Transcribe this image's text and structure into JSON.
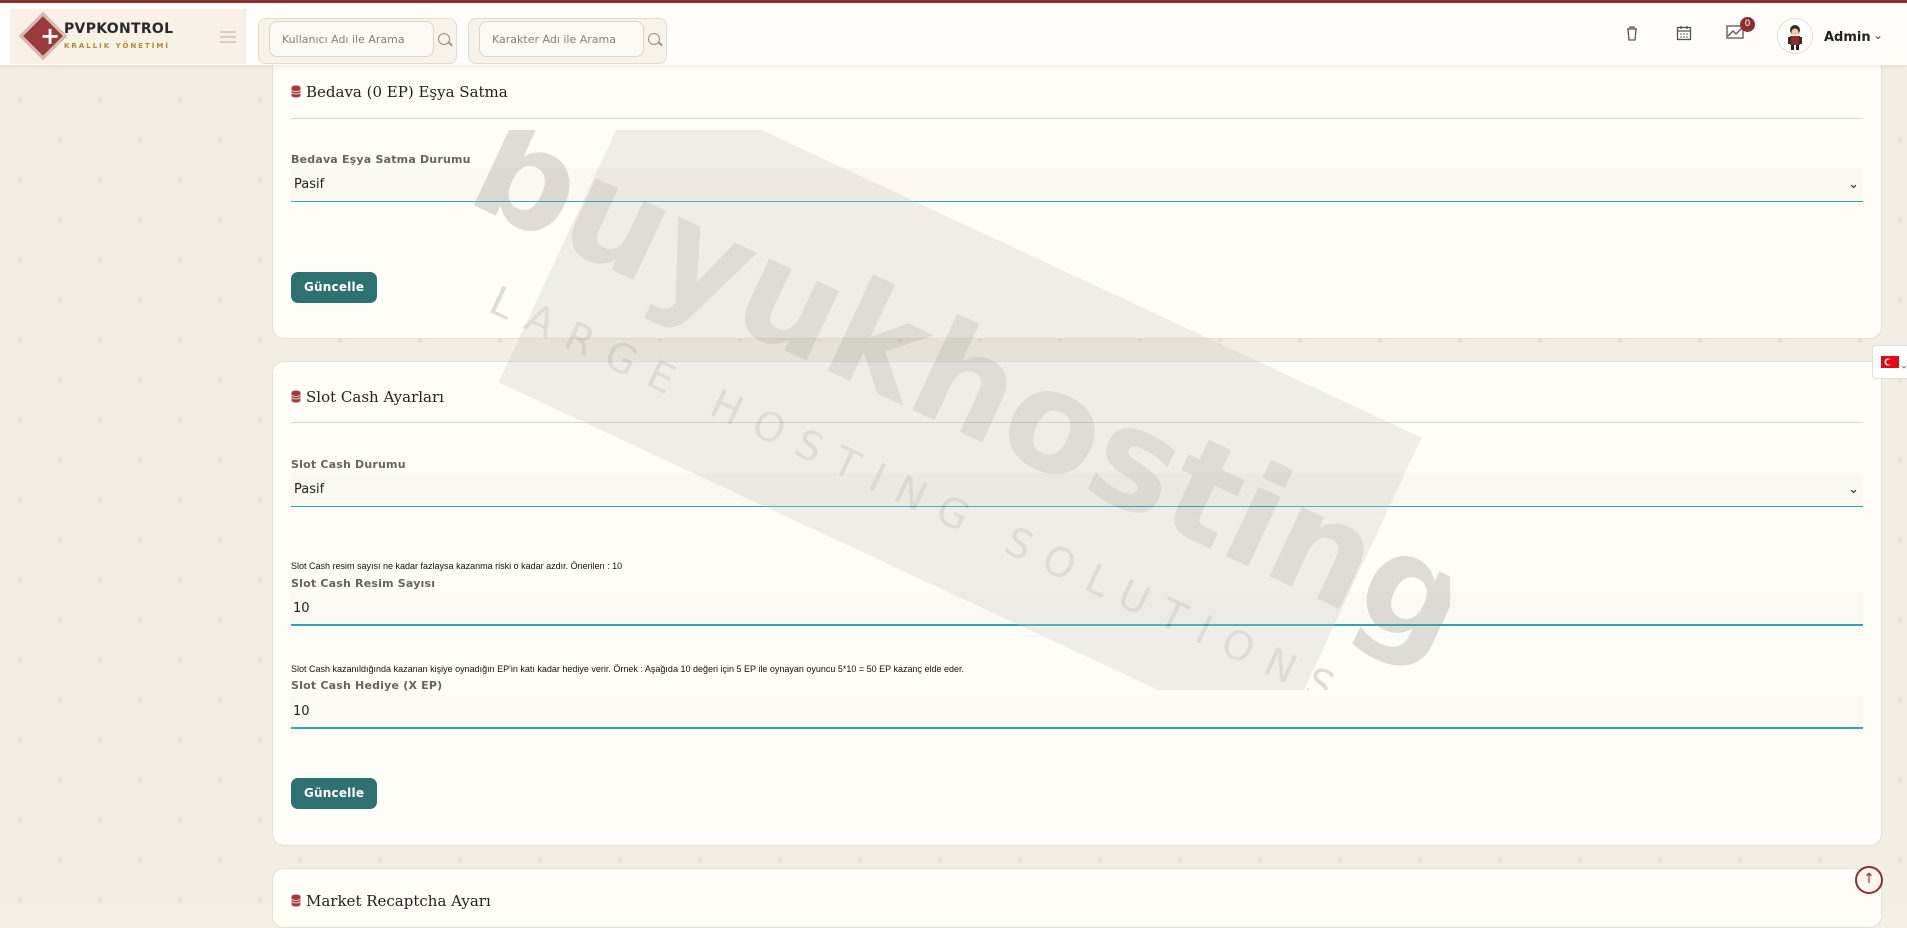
{
  "brand": {
    "title": "PVPKONTROL",
    "subtitle": "KRALLIK YÖNETİMİ"
  },
  "search": {
    "username_placeholder": "Kullanıcı Adı ile Arama",
    "character_placeholder": "Karakter Adı ile Arama"
  },
  "header": {
    "notification_count": "0",
    "user_name": "Admin"
  },
  "colors": {
    "accent": "#8b2f2f",
    "button": "#2e7171",
    "input_underline": "#2aa6b8"
  },
  "sections": [
    {
      "title": "Bedava (0 EP) Eşya Satma",
      "fields": [
        {
          "label": "Bedava Eşya Satma Durumu",
          "value": "Pasif"
        }
      ],
      "button": "Güncelle"
    },
    {
      "title": "Slot Cash Ayarları",
      "fields": [
        {
          "label": "Slot Cash Durumu",
          "value": "Pasif"
        },
        {
          "hint": "Slot Cash resim sayısı ne kadar fazlaysa kazanma riski o kadar azdır. Önerilen : 10",
          "label": "Slot Cash Resim Sayısı",
          "value": "10"
        },
        {
          "hint": "Slot Cash kazanıldığında kazanan kişiye oynadığın EP'in katı kadar hediye verir. Örnek : Aşağıda 10 değeri için 5 EP ile oynayan oyuncu 5*10 = 50 EP kazanç elde eder.",
          "label": "Slot Cash Hediye (X EP)",
          "value": "10"
        }
      ],
      "button": "Güncelle"
    },
    {
      "title": "Market Recaptcha Ayarı"
    }
  ],
  "watermark": {
    "main": "buyukhosting",
    "sub": "LARGE HOSTING SOLUTIONS"
  },
  "icons": [
    "trash-icon",
    "calendar-icon",
    "chart-mail-icon",
    "chevron-down-icon",
    "database-icon",
    "flag-tr-icon",
    "arrow-up-icon"
  ]
}
